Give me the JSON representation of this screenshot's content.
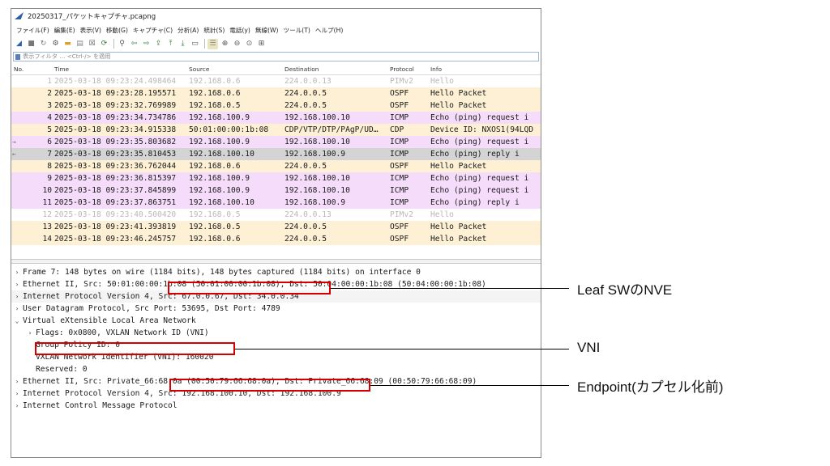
{
  "window": {
    "title": "20250317_パケットキャプチャ.pcapng"
  },
  "menu": [
    "ファイル(F)",
    "編集(E)",
    "表示(V)",
    "移動(G)",
    "キャプチャ(C)",
    "分析(A)",
    "統計(S)",
    "電話(y)",
    "無線(W)",
    "ツール(T)",
    "ヘルプ(H)"
  ],
  "filter": {
    "placeholder": "表示フィルタ … <Ctrl-/> を適用"
  },
  "columns": {
    "no": "No.",
    "time": "Time",
    "source": "Source",
    "destination": "Destination",
    "protocol": "Protocol",
    "info": "Info"
  },
  "packets": [
    {
      "no": "1",
      "time": "2025-03-18 09:23:24.498464",
      "src": "192.168.0.6",
      "dst": "224.0.0.13",
      "proto": "PIMv2",
      "info": "Hello",
      "kind": "pim",
      "mark": ""
    },
    {
      "no": "2",
      "time": "2025-03-18 09:23:28.195571",
      "src": "192.168.0.6",
      "dst": "224.0.0.5",
      "proto": "OSPF",
      "info": "Hello Packet",
      "kind": "ospf",
      "mark": ""
    },
    {
      "no": "3",
      "time": "2025-03-18 09:23:32.769989",
      "src": "192.168.0.5",
      "dst": "224.0.0.5",
      "proto": "OSPF",
      "info": "Hello Packet",
      "kind": "ospf",
      "mark": ""
    },
    {
      "no": "4",
      "time": "2025-03-18 09:23:34.734786",
      "src": "192.168.100.9",
      "dst": "192.168.100.10",
      "proto": "ICMP",
      "info": "Echo (ping) request  i",
      "kind": "icmp",
      "mark": ""
    },
    {
      "no": "5",
      "time": "2025-03-18 09:23:34.915338",
      "src": "50:01:00:00:1b:08",
      "dst": "CDP/VTP/DTP/PAgP/UD…",
      "proto": "CDP",
      "info": "Device ID: NXOS1(94LQD",
      "kind": "cdp",
      "mark": ""
    },
    {
      "no": "6",
      "time": "2025-03-18 09:23:35.803682",
      "src": "192.168.100.9",
      "dst": "192.168.100.10",
      "proto": "ICMP",
      "info": "Echo (ping) request  i",
      "kind": "icmp",
      "mark": "→"
    },
    {
      "no": "7",
      "time": "2025-03-18 09:23:35.810453",
      "src": "192.168.100.10",
      "dst": "192.168.100.9",
      "proto": "ICMP",
      "info": "Echo (ping) reply    i",
      "kind": "selected",
      "mark": "←"
    },
    {
      "no": "8",
      "time": "2025-03-18 09:23:36.762044",
      "src": "192.168.0.6",
      "dst": "224.0.0.5",
      "proto": "OSPF",
      "info": "Hello Packet",
      "kind": "ospf",
      "mark": ""
    },
    {
      "no": "9",
      "time": "2025-03-18 09:23:36.815397",
      "src": "192.168.100.9",
      "dst": "192.168.100.10",
      "proto": "ICMP",
      "info": "Echo (ping) request  i",
      "kind": "icmp",
      "mark": ""
    },
    {
      "no": "10",
      "time": "2025-03-18 09:23:37.845899",
      "src": "192.168.100.9",
      "dst": "192.168.100.10",
      "proto": "ICMP",
      "info": "Echo (ping) request  i",
      "kind": "icmp",
      "mark": ""
    },
    {
      "no": "11",
      "time": "2025-03-18 09:23:37.863751",
      "src": "192.168.100.10",
      "dst": "192.168.100.9",
      "proto": "ICMP",
      "info": "Echo (ping) reply    i",
      "kind": "icmp",
      "mark": ""
    },
    {
      "no": "12",
      "time": "2025-03-18 09:23:40.500420",
      "src": "192.168.0.5",
      "dst": "224.0.0.13",
      "proto": "PIMv2",
      "info": "Hello",
      "kind": "pim",
      "mark": ""
    },
    {
      "no": "13",
      "time": "2025-03-18 09:23:41.393819",
      "src": "192.168.0.5",
      "dst": "224.0.0.5",
      "proto": "OSPF",
      "info": "Hello Packet",
      "kind": "ospf",
      "mark": ""
    },
    {
      "no": "14",
      "time": "2025-03-18 09:23:46.245757",
      "src": "192.168.0.6",
      "dst": "224.0.0.5",
      "proto": "OSPF",
      "info": "Hello Packet",
      "kind": "ospf",
      "mark": ""
    }
  ],
  "details": [
    {
      "arrow": "›",
      "text": "Frame 7: 148 bytes on wire (1184 bits), 148 bytes captured (1184 bits) on interface 0",
      "indent": 0
    },
    {
      "arrow": "›",
      "text": "Ethernet II, Src: 50:01:00:00:1b:08 (50:01:00:00:1b:08), Dst: 50:04:00:00:1b:08 (50:04:00:00:1b:08)",
      "indent": 0
    },
    {
      "arrow": "›",
      "text": "Internet Protocol Version 4, Src: 67.0.0.67, Dst: 34.0.0.34",
      "indent": 0
    },
    {
      "arrow": "›",
      "text": "User Datagram Protocol, Src Port: 53695, Dst Port: 4789",
      "indent": 0
    },
    {
      "arrow": "⌄",
      "text": "Virtual eXtensible Local Area Network",
      "indent": 0
    },
    {
      "arrow": "›",
      "text": "Flags: 0x0800, VXLAN Network ID (VNI)",
      "indent": 1
    },
    {
      "arrow": "",
      "text": "Group Policy ID: 0",
      "indent": 1
    },
    {
      "arrow": "",
      "text": "VXLAN Network Identifier (VNI): 160020",
      "indent": 1
    },
    {
      "arrow": "",
      "text": "Reserved: 0",
      "indent": 1
    },
    {
      "arrow": "›",
      "text": "Ethernet II, Src: Private_66:68:0a (00:50:79:66:68:0a), Dst: Private_66:68:09 (00:50:79:66:68:09)",
      "indent": 0
    },
    {
      "arrow": "›",
      "text": "Internet Protocol Version 4, Src: 192.168.100.10, Dst: 192.168.100.9",
      "indent": 0
    },
    {
      "arrow": "›",
      "text": "Internet Control Message Protocol",
      "indent": 0
    }
  ],
  "callouts": {
    "nve": "Leaf SWのNVE",
    "vni": "VNI",
    "endpoint": "Endpoint(カプセル化前)"
  },
  "colors": {
    "highlight_box": "#d40000",
    "ospf_row": "#fdf0d4",
    "icmp_row": "#f6dcfb",
    "selected_row": "#d4d4d4"
  }
}
